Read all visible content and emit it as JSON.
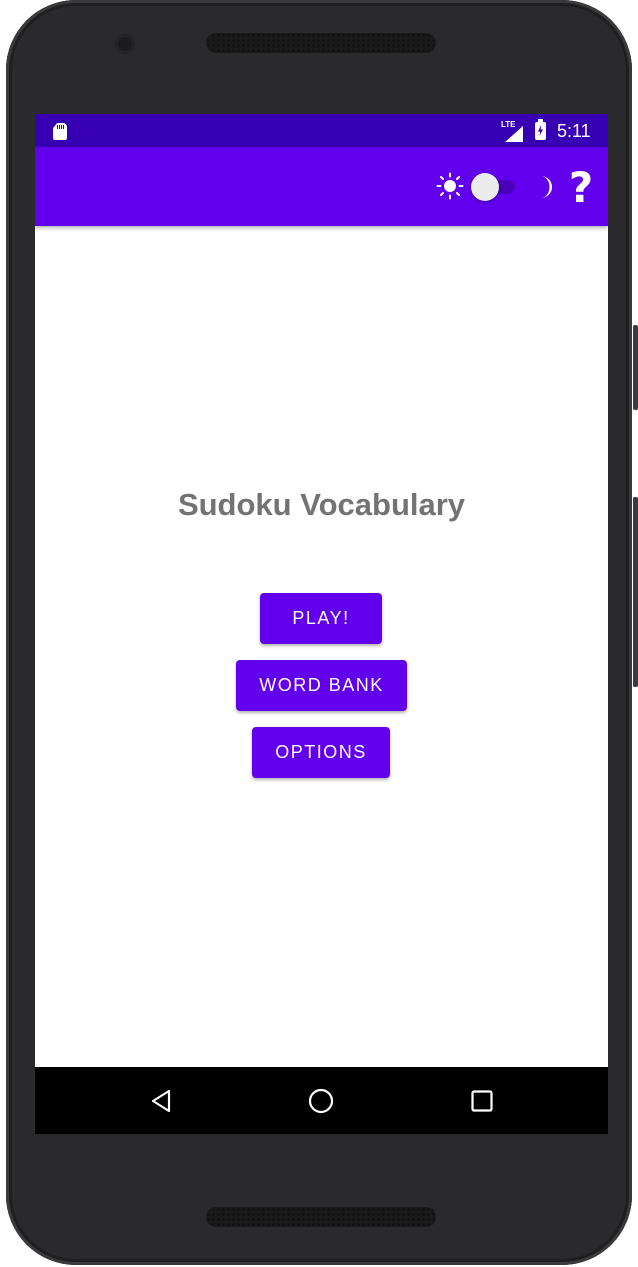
{
  "status_bar": {
    "time": "5:11",
    "network_label": "LTE"
  },
  "app_bar": {
    "icons": [
      "sun-icon",
      "theme-toggle",
      "moon-icon",
      "help-icon"
    ],
    "dark_mode_enabled": false,
    "help_glyph": "?"
  },
  "main": {
    "title": "Sudoku Vocabulary",
    "buttons": {
      "play": "PLAY!",
      "word_bank": "WORD BANK",
      "options": "OPTIONS"
    }
  },
  "nav_bar": {
    "icons": [
      "back-icon",
      "home-icon",
      "recents-icon"
    ]
  },
  "colors": {
    "primary": "#6200ee",
    "primary_dark": "#3700b3",
    "title_text": "#737373",
    "background": "#ffffff"
  }
}
